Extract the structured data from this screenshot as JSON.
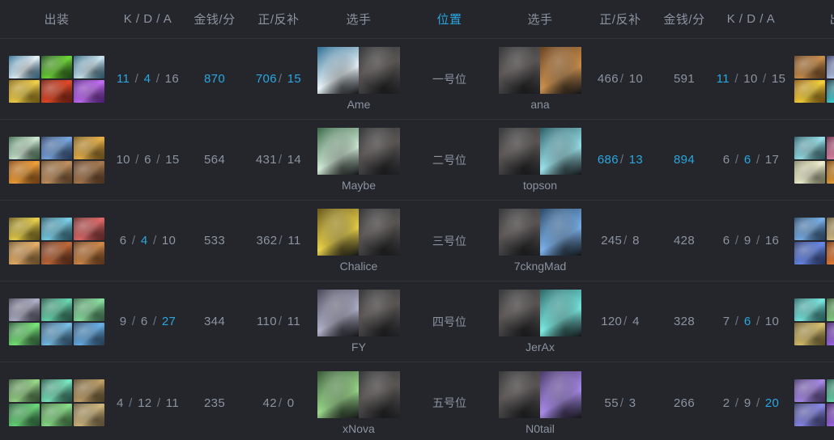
{
  "colors": {
    "background": "#24262b",
    "text": "#8c93a0",
    "highlight": "#2aa7e0",
    "divider": "#2f3238"
  },
  "header": {
    "columns": [
      {
        "label": "出装",
        "key": "items-left",
        "active": false
      },
      {
        "label": "K / D / A",
        "key": "kda-left",
        "active": false
      },
      {
        "label": "金钱/分",
        "key": "gpm-left",
        "active": false
      },
      {
        "label": "正/反补",
        "key": "cs-left",
        "active": false
      },
      {
        "label": "选手",
        "key": "player-left",
        "active": false
      },
      {
        "label": "位置",
        "key": "position",
        "active": true
      },
      {
        "label": "选手",
        "key": "player-right",
        "active": false
      },
      {
        "label": "正/反补",
        "key": "cs-right",
        "active": false
      },
      {
        "label": "金钱/分",
        "key": "gpm-right",
        "active": false
      },
      {
        "label": "K / D / A",
        "key": "kda-right",
        "active": false
      },
      {
        "label": "出装",
        "key": "items-right",
        "active": false
      }
    ]
  },
  "rows": [
    {
      "position": "一号位",
      "left": {
        "player": "Ame",
        "kills": "11",
        "deaths": "4",
        "assists": "16",
        "kills_hi": true,
        "deaths_hi": true,
        "assists_hi": false,
        "gpm": "870",
        "gpm_hi": true,
        "cs": "706",
        "denies": "15",
        "cs_hi": true,
        "denies_hi": true,
        "items": [
          {
            "color1": "#2e6f94",
            "color2": "#e8f2f7"
          },
          {
            "color1": "#1f4f1c",
            "color2": "#6fd637"
          },
          {
            "color1": "#2a5f7a",
            "color2": "#cfe8f2"
          },
          {
            "color1": "#8a6a12",
            "color2": "#f0cf4a"
          },
          {
            "color1": "#7a1f12",
            "color2": "#e04a28"
          },
          {
            "color1": "#5a1f8a",
            "color2": "#c06ef0"
          }
        ]
      },
      "right": {
        "player": "ana",
        "kills": "11",
        "deaths": "10",
        "assists": "15",
        "kills_hi": true,
        "deaths_hi": false,
        "assists_hi": false,
        "gpm": "591",
        "gpm_hi": false,
        "cs": "466",
        "denies": "10",
        "cs_hi": false,
        "denies_hi": false,
        "items": [
          {
            "color1": "#6b4320",
            "color2": "#c98f4e"
          },
          {
            "color1": "#3a3f6a",
            "color2": "#b9c8e8"
          },
          {
            "color1": "#2e6f6a",
            "color2": "#e0d07a"
          },
          {
            "color1": "#8a5a12",
            "color2": "#f5d23a"
          },
          {
            "color1": "#2a3a4a",
            "color2": "#45d8d8"
          },
          {
            "color1": "#7a2412",
            "color2": "#e86a2a"
          }
        ]
      }
    },
    {
      "position": "二号位",
      "left": {
        "player": "Maybe",
        "kills": "10",
        "deaths": "6",
        "assists": "15",
        "kills_hi": false,
        "deaths_hi": false,
        "assists_hi": false,
        "gpm": "564",
        "gpm_hi": false,
        "cs": "431",
        "denies": "14",
        "cs_hi": false,
        "denies_hi": false,
        "items": [
          {
            "color1": "#3c6a4a",
            "color2": "#cfe8d4"
          },
          {
            "color1": "#2a3f6a",
            "color2": "#7aa8e0"
          },
          {
            "color1": "#7a5a1a",
            "color2": "#e8b24a"
          },
          {
            "color1": "#8a4a12",
            "color2": "#f0a03a"
          },
          {
            "color1": "#6a4a2a",
            "color2": "#c09060"
          },
          {
            "color1": "#5a3a24",
            "color2": "#a87a50"
          }
        ]
      },
      "right": {
        "player": "topson",
        "kills": "6",
        "deaths": "6",
        "assists": "17",
        "kills_hi": false,
        "deaths_hi": true,
        "assists_hi": false,
        "gpm": "894",
        "gpm_hi": true,
        "cs": "686",
        "denies": "13",
        "cs_hi": true,
        "denies_hi": true,
        "items": [
          {
            "color1": "#2a5f6a",
            "color2": "#9ae0e8"
          },
          {
            "color1": "#6a2a4a",
            "color2": "#e08aa8"
          },
          {
            "color1": "#2a6a5a",
            "color2": "#6ae8c0"
          },
          {
            "color1": "#8a8a6a",
            "color2": "#f0f0d0"
          },
          {
            "color1": "#7a4a12",
            "color2": "#e8a03a"
          },
          {
            "color1": "#3a2a1a",
            "color2": "#8a6a4a"
          }
        ]
      }
    },
    {
      "position": "三号位",
      "left": {
        "player": "Chalice",
        "kills": "6",
        "deaths": "4",
        "assists": "10",
        "kills_hi": false,
        "deaths_hi": true,
        "assists_hi": false,
        "gpm": "533",
        "gpm_hi": false,
        "cs": "362",
        "denies": "11",
        "cs_hi": false,
        "denies_hi": false,
        "items": [
          {
            "color1": "#6a5a1a",
            "color2": "#e8d04a"
          },
          {
            "color1": "#2a5a6a",
            "color2": "#7ad0e8"
          },
          {
            "color1": "#6a2a2a",
            "color2": "#e06a6a"
          },
          {
            "color1": "#7a5a2a",
            "color2": "#e8b06a"
          },
          {
            "color1": "#5a2a1a",
            "color2": "#c06a3a"
          },
          {
            "color1": "#6a3a1a",
            "color2": "#d08a4a"
          }
        ]
      },
      "right": {
        "player": "7ckngMad",
        "kills": "6",
        "deaths": "9",
        "assists": "16",
        "kills_hi": false,
        "deaths_hi": false,
        "assists_hi": false,
        "gpm": "428",
        "gpm_hi": false,
        "cs": "245",
        "denies": "8",
        "cs_hi": false,
        "denies_hi": false,
        "items": [
          {
            "color1": "#2a4a6a",
            "color2": "#7ab0e8"
          },
          {
            "color1": "#6a5a3a",
            "color2": "#d8c08a"
          },
          {
            "color1": "#3a4a6a",
            "color2": "#8ab8e8"
          },
          {
            "color1": "#2a3a6a",
            "color2": "#6a8ae8"
          },
          {
            "color1": "#7a3a12",
            "color2": "#e8803a"
          },
          {
            "color1": "#2a5a2a",
            "color2": "#6ad86a"
          }
        ]
      }
    },
    {
      "position": "四号位",
      "left": {
        "player": "FY",
        "kills": "9",
        "deaths": "6",
        "assists": "27",
        "kills_hi": false,
        "deaths_hi": false,
        "assists_hi": true,
        "gpm": "344",
        "gpm_hi": false,
        "cs": "110",
        "denies": "11",
        "cs_hi": false,
        "denies_hi": false,
        "items": [
          {
            "color1": "#4a4a5a",
            "color2": "#b0b0c8"
          },
          {
            "color1": "#2a5a4a",
            "color2": "#6ad8b0"
          },
          {
            "color1": "#3a6a4a",
            "color2": "#8ae0a0"
          },
          {
            "color1": "#2a5a3a",
            "color2": "#7ae87a"
          },
          {
            "color1": "#2a4a6a",
            "color2": "#7ac0e8"
          },
          {
            "color1": "#2a4a6a",
            "color2": "#6ab0e8"
          }
        ]
      },
      "right": {
        "player": "JerAx",
        "kills": "7",
        "deaths": "6",
        "assists": "10",
        "kills_hi": false,
        "deaths_hi": true,
        "assists_hi": false,
        "gpm": "328",
        "gpm_hi": false,
        "cs": "120",
        "denies": "4",
        "cs_hi": false,
        "denies_hi": false,
        "items": [
          {
            "color1": "#2a6a6a",
            "color2": "#7ae8e0"
          },
          {
            "color1": "#3a5a3a",
            "color2": "#8ad88a"
          },
          {
            "color1": "#2a6a4a",
            "color2": "#6ae8a0"
          },
          {
            "color1": "#6a5a2a",
            "color2": "#d8c070"
          },
          {
            "color1": "#4a2a6a",
            "color2": "#a06ae8"
          },
          {
            "color1": "#202329",
            "color2": "#202329",
            "empty": true
          }
        ]
      }
    },
    {
      "position": "五号位",
      "left": {
        "player": "xNova",
        "kills": "4",
        "deaths": "12",
        "assists": "11",
        "kills_hi": false,
        "deaths_hi": false,
        "assists_hi": false,
        "gpm": "235",
        "gpm_hi": false,
        "cs": "42",
        "denies": "0",
        "cs_hi": false,
        "denies_hi": false,
        "items": [
          {
            "color1": "#3a5a3a",
            "color2": "#9ad88a"
          },
          {
            "color1": "#2a5a4a",
            "color2": "#7ae8c0"
          },
          {
            "color1": "#5a4a2a",
            "color2": "#c0a06a"
          },
          {
            "color1": "#2a5a3a",
            "color2": "#6ad87a"
          },
          {
            "color1": "#3a6a3a",
            "color2": "#8ae08a"
          },
          {
            "color1": "#6a5a3a",
            "color2": "#d0b880"
          }
        ]
      },
      "right": {
        "player": "N0tail",
        "kills": "2",
        "deaths": "9",
        "assists": "20",
        "kills_hi": false,
        "deaths_hi": false,
        "assists_hi": true,
        "gpm": "266",
        "gpm_hi": false,
        "cs": "55",
        "denies": "3",
        "cs_hi": false,
        "denies_hi": false,
        "items": [
          {
            "color1": "#4a3a6a",
            "color2": "#a88ae8"
          },
          {
            "color1": "#2a5a4a",
            "color2": "#6ad8b0"
          },
          {
            "color1": "#3a6a4a",
            "color2": "#8ae0a0"
          },
          {
            "color1": "#3a3a6a",
            "color2": "#8a8ae8"
          },
          {
            "color1": "#4a2a6a",
            "color2": "#a06ae8"
          },
          {
            "color1": "#2a5a4a",
            "color2": "#6ad8a0"
          }
        ]
      }
    }
  ]
}
